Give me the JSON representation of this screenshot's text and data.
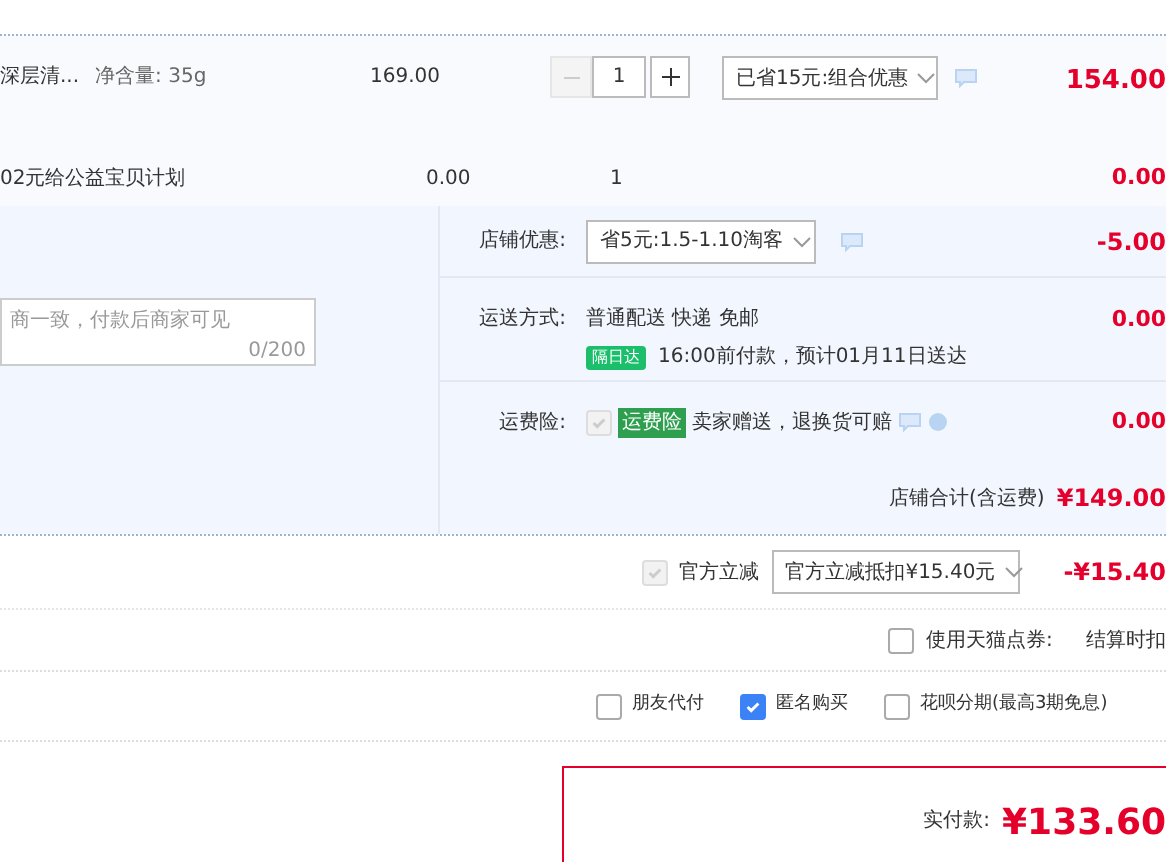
{
  "item": {
    "title": "深层清...",
    "spec": "净含量: 35g",
    "unit_price": "169.00",
    "quantity": "1",
    "minus_disabled": true,
    "promo": "已省15元:组合优惠",
    "subtotal": "154.00"
  },
  "charity": {
    "title": "02元给公益宝贝计划",
    "price": "0.00",
    "quantity": "1",
    "subtotal": "0.00"
  },
  "shop": {
    "message": {
      "placeholder": "商一致，付款后商家可见",
      "count": "0/200"
    },
    "discount": {
      "label": "店铺优惠:",
      "value": "省5元:1.5-1.10淘客",
      "amount": "-5.00"
    },
    "shipping": {
      "label": "运送方式:",
      "method": "普通配送 快递 免邮",
      "badge": "隔日达",
      "eta": "16:00前付款，预计01月11日送达",
      "amount": "0.00"
    },
    "insurance": {
      "label": "运费险:",
      "checked": true,
      "badge": "运费险",
      "text": "卖家赠送，退换货可赔",
      "amount": "0.00"
    },
    "total": {
      "label": "店铺合计(含运费)",
      "amount": "¥149.00"
    }
  },
  "official": {
    "checked": true,
    "label": "官方立减",
    "value": "官方立减抵扣¥15.40元",
    "amount": "-¥15.40"
  },
  "coupon": {
    "checked": false,
    "label": "使用天猫点券:",
    "note": "结算时扣"
  },
  "options": [
    {
      "label": "朋友代付",
      "checked": false
    },
    {
      "label": "匿名购买",
      "checked": true
    },
    {
      "label": "花呗分期(最高3期免息)",
      "checked": false
    }
  ],
  "pay": {
    "label": "实付款:",
    "amount": "¥133.60"
  }
}
